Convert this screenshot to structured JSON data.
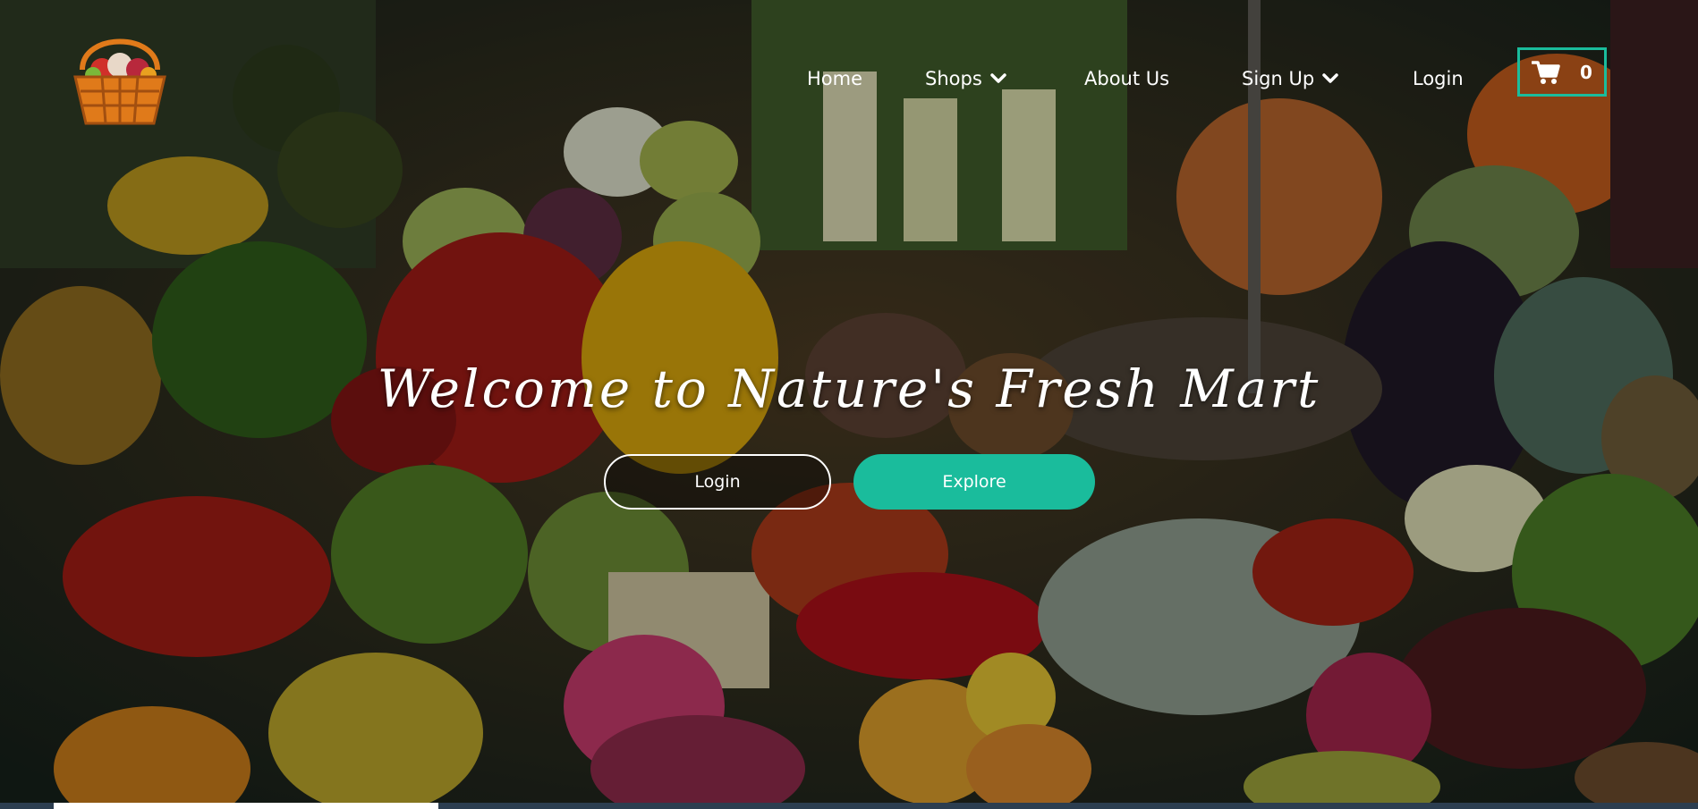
{
  "nav": {
    "home": "Home",
    "shops": "Shops",
    "about": "About Us",
    "signup": "Sign Up",
    "login": "Login"
  },
  "cart": {
    "count": "0",
    "icon": "cart-icon"
  },
  "hero": {
    "headline": "Welcome to Nature's Fresh Mart",
    "login_button": "Login",
    "explore_button": "Explore"
  },
  "icons": {
    "logo": "basket-logo-icon",
    "dropdown": "chevron-down-icon"
  },
  "colors": {
    "accent": "#1abc9c",
    "text": "#ffffff"
  }
}
